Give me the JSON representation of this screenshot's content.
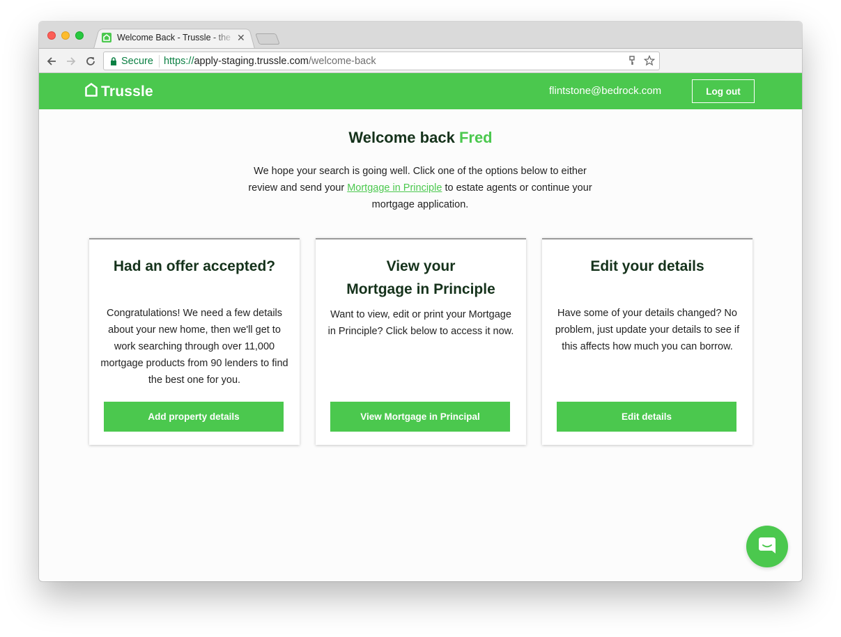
{
  "browser": {
    "tab_title": "Welcome Back - Trussle - the",
    "security_label": "Secure",
    "url": {
      "protocol": "https://",
      "host": "apply-staging.trussle.com",
      "path": "/welcome-back"
    }
  },
  "header": {
    "logo_text": "Trussle",
    "user_email": "flintstone@bedrock.com",
    "logout_label": "Log out"
  },
  "main": {
    "welcome_prefix": "Welcome back",
    "welcome_name": "Fred",
    "intro_before": "We hope your search is going well. Click one of the options below to either review and send your ",
    "intro_link": "Mortgage in Principle",
    "intro_after": " to estate agents or continue your mortgage application."
  },
  "cards": [
    {
      "title": "Had an offer accepted?",
      "body": "Congratulations! We need a few details about your new home, then we'll get to work searching through over 11,000 mortgage products from 90 lenders to find the best one for you.",
      "button": "Add property details"
    },
    {
      "title_line1": "View your",
      "title_line2": "Mortgage in Principle",
      "body": "Want to view, edit or print your Mortgage in Principle? Click below to access it now.",
      "button": "View Mortgage in Principal"
    },
    {
      "title": "Edit your details",
      "body": "Have some of your details changed? No problem, just update your details to see if this affects how much you can borrow.",
      "button": "Edit details"
    }
  ],
  "colors": {
    "brand": "#4bc84e",
    "heading": "#15321b"
  },
  "icons": {
    "chat": "chat-icon",
    "logo": "house-icon"
  }
}
